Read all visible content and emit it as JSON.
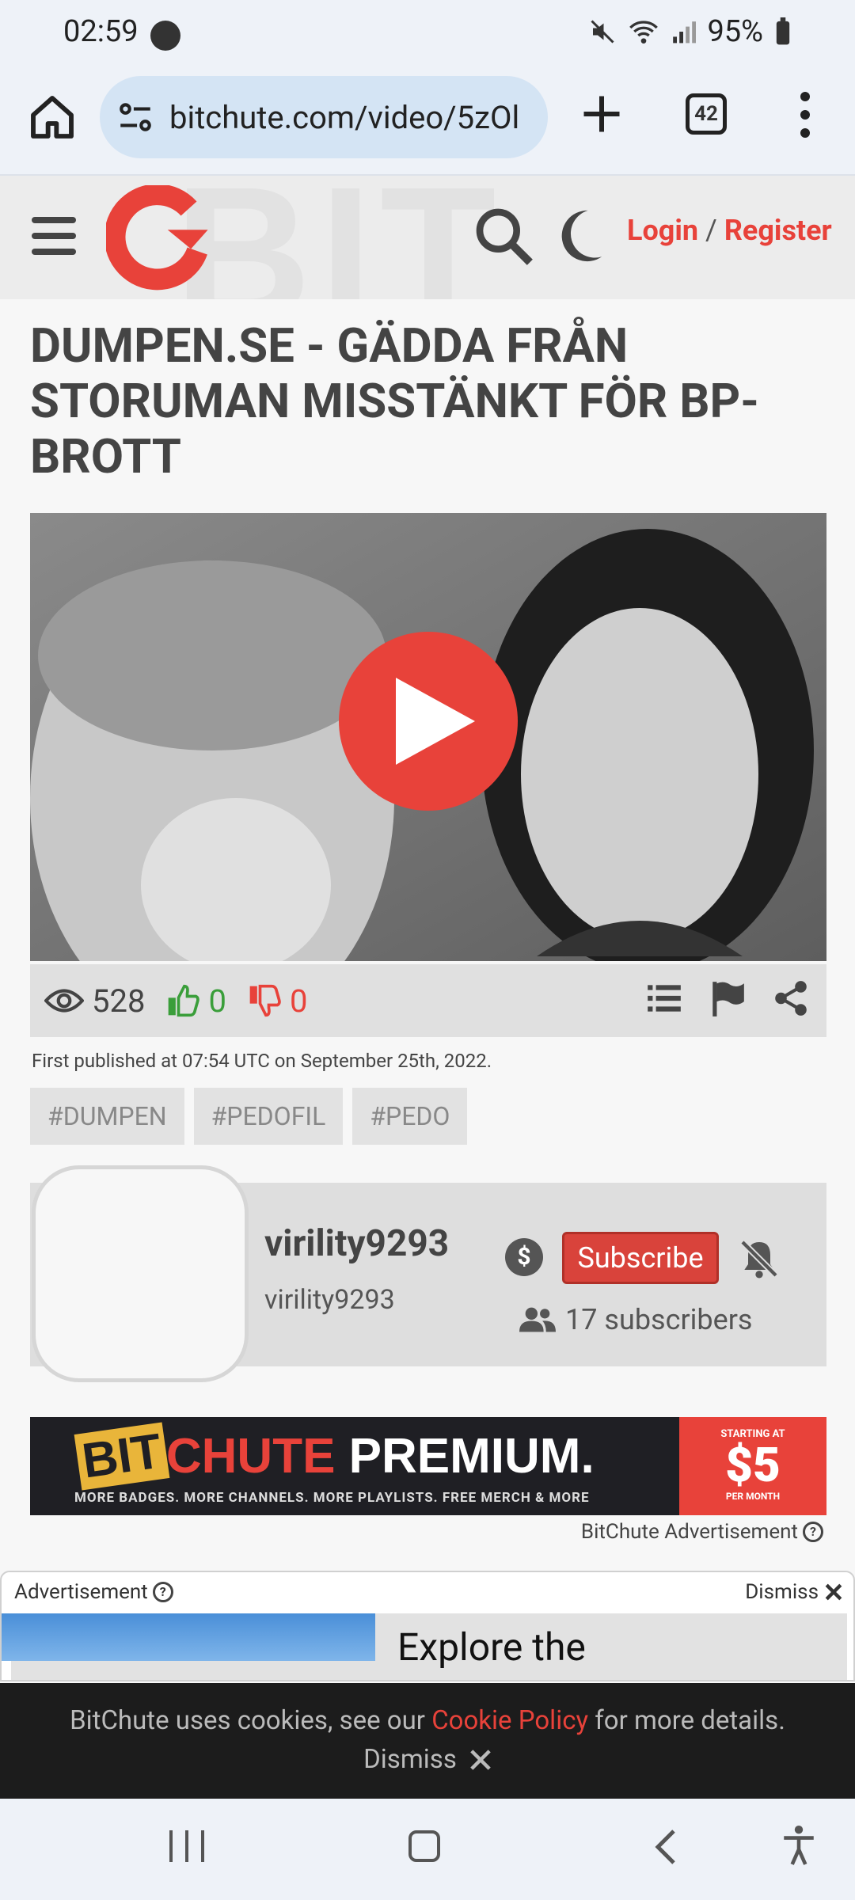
{
  "status_bar": {
    "time": "02:59",
    "battery": "95%"
  },
  "browser": {
    "url": "bitchute.com/video/5zOl",
    "tab_count": "42"
  },
  "header": {
    "login": "Login",
    "separator": "/",
    "register": "Register",
    "bg_text": "BIT"
  },
  "video": {
    "title": "DUMPEN.SE - GÄDDA FRÅN STORUMAN MISSTÄNKT FÖR BP-BROTT",
    "views": "528",
    "likes": "0",
    "dislikes": "0",
    "published": "First published at 07:54 UTC on September 25th, 2022.",
    "tags": [
      "#DUMPEN",
      "#PEDOFIL",
      "#PEDO"
    ]
  },
  "channel": {
    "name": "virility9293",
    "handle": "virility9293",
    "subscribe_label": "Subscribe",
    "subscribers": "17 subscribers"
  },
  "premium_banner": {
    "bit": "BIT",
    "chute": "CHUTE",
    "premium": "PREMIUM.",
    "tagline": "MORE BADGES. MORE CHANNELS. MORE PLAYLISTS. FREE MERCH & MORE",
    "starting_at": "STARTING AT",
    "price": "$5",
    "per_month": "PER MONTH"
  },
  "bitchute_ad_label": "BitChute Advertisement",
  "ad": {
    "label": "Advertisement",
    "dismiss": "Dismiss",
    "headline": "Explore the"
  },
  "cookie": {
    "text_before": "BitChute uses cookies, see our ",
    "policy_link": "Cookie Policy",
    "text_after": " for more details.",
    "dismiss": "Dismiss"
  },
  "colors": {
    "brand_red": "#e8423a",
    "like_green": "#3a9e3a"
  }
}
